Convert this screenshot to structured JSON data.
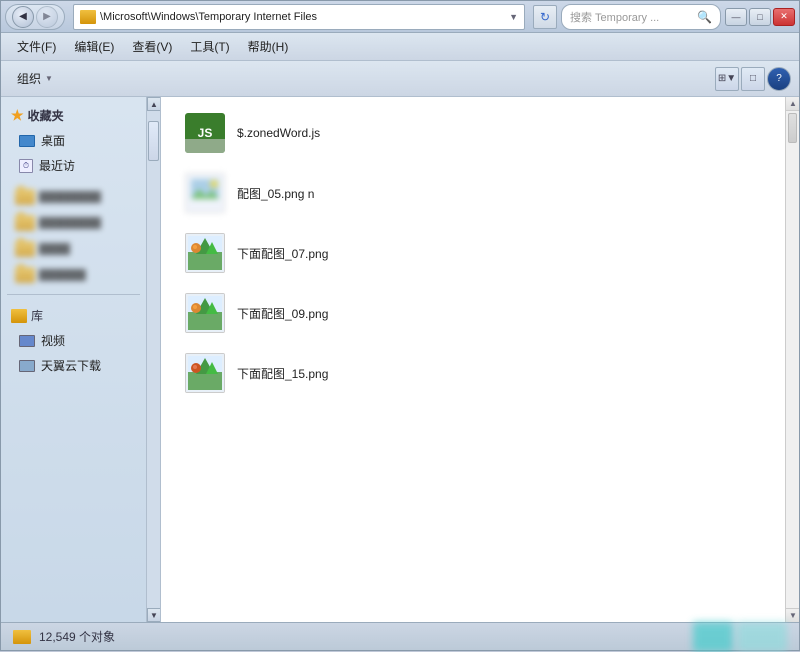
{
  "window": {
    "title": "Temporary Internet Files",
    "controls": {
      "minimize": "—",
      "maximize": "□",
      "close": "✕"
    }
  },
  "title_bar": {
    "address_path": "\\Microsoft\\Windows\\Temporary Internet Files",
    "search_placeholder": "搜索 Temporary ... 🔍",
    "refresh_icon": "↻"
  },
  "menu": {
    "items": [
      "文件(F)",
      "编辑(E)",
      "查看(V)",
      "工具(T)",
      "帮助(H)"
    ]
  },
  "toolbar": {
    "organize_label": "组织",
    "dropdown_char": "▼",
    "view_icon_1": "⊞",
    "view_icon_2": "□",
    "help_icon": "?"
  },
  "sidebar": {
    "favorites_label": "收藏夹",
    "desktop_label": "桌面",
    "recent_label": "最近访",
    "library_label": "库",
    "video_label": "视频",
    "cloud_label": "天翼云下载"
  },
  "files": [
    {
      "name": "$.zonedWord.js",
      "type": "js",
      "icon_label": "JS"
    },
    {
      "name": "配图_05.png\nn",
      "type": "png_blurred",
      "icon_label": "IMG"
    },
    {
      "name": "下面配图_07.png",
      "type": "png",
      "icon_label": "IMG7"
    },
    {
      "name": "下面配图_09.png",
      "type": "png",
      "icon_label": "IMG9"
    },
    {
      "name": "下面配图_15.png",
      "type": "png",
      "icon_label": "IMG15"
    }
  ],
  "status": {
    "count_text": "12,549 个对象"
  }
}
